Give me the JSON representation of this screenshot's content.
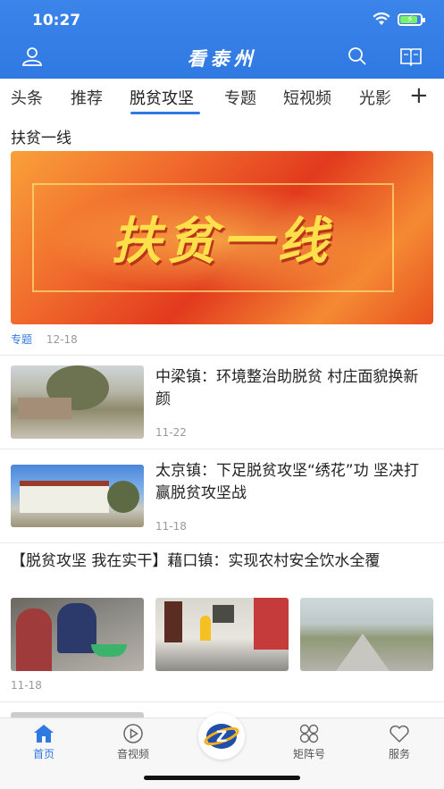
{
  "status": {
    "time": "10:27"
  },
  "header": {
    "title": "看泰州"
  },
  "tabs": [
    {
      "label": "头条"
    },
    {
      "label": "推荐"
    },
    {
      "label": "脱贫攻坚",
      "active": true
    },
    {
      "label": "专题"
    },
    {
      "label": "短视频"
    },
    {
      "label": "光影"
    }
  ],
  "section": {
    "title": "扶贫一线",
    "banner_text": "扶贫一线",
    "tag": "专题",
    "date": "12-18"
  },
  "news": [
    {
      "title": "中梁镇：环境整治助脱贫 村庄面貌换新颜",
      "date": "11-22"
    },
    {
      "title": "太京镇：下足脱贫攻坚“绣花”功 坚决打赢脱贫攻坚战",
      "date": "11-18"
    }
  ],
  "gallery_news": {
    "title": "【脱贫攻坚 我在实干】藉口镇：实现农村安全饮水全覆",
    "date": "11-18"
  },
  "bottom_nav": [
    {
      "label": "首页",
      "icon": "home-icon",
      "active": true
    },
    {
      "label": "音视频",
      "icon": "play-icon"
    },
    {
      "label": "矩阵号",
      "icon": "matrix-icon"
    },
    {
      "label": "服务",
      "icon": "heart-icon"
    }
  ],
  "colors": {
    "accent": "#2f79e2",
    "header": "#3a84ea",
    "meta": "#999999"
  }
}
